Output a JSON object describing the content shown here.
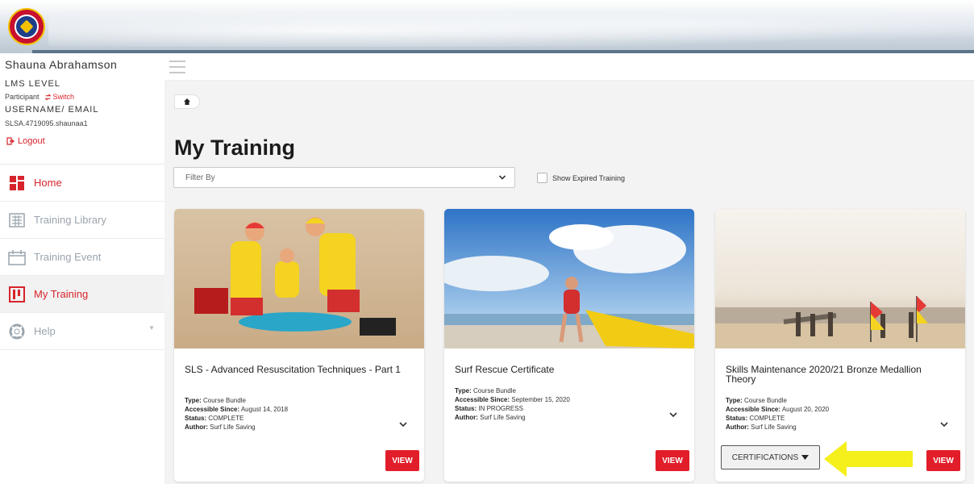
{
  "colors": {
    "brand_red": "#e21d2a",
    "sidebar_red": "#d6242a",
    "title_dark": "#1b1b1b",
    "highlight_yellow": "#f5ef1c"
  },
  "user": {
    "name": "Shauna Abrahamson",
    "lms_level_label": "LMS LEVEL",
    "role": "Participant",
    "switch_label": "Switch",
    "username_label": "USERNAME/ EMAIL",
    "username_value": "SLSA.4719095.shaunaa1",
    "logout_label": "Logout"
  },
  "nav": {
    "items": [
      {
        "label": "Home",
        "icon": "home-grid-icon"
      },
      {
        "label": "Training Library",
        "icon": "library-icon"
      },
      {
        "label": "Training Event",
        "icon": "calendar-icon"
      },
      {
        "label": "My Training",
        "icon": "my-training-icon"
      },
      {
        "label": "Help",
        "icon": "lifebuoy-icon"
      }
    ]
  },
  "main": {
    "title": "My Training",
    "filter_placeholder": "Filter By",
    "show_expired_label": "Show Expired Training"
  },
  "cards": [
    {
      "title": "SLS - Advanced Resuscitation Techniques - Part 1",
      "type_label": "Type:",
      "type": "Course Bundle",
      "accessible_label": "Accessible Since:",
      "accessible": "August 14, 2018",
      "status_label": "Status:",
      "status": "COMPLETE",
      "author_label": "Author:",
      "author": "Surf Life Saving",
      "view_label": "VIEW"
    },
    {
      "title": "Surf Rescue Certificate",
      "type_label": "Type:",
      "type": "Course Bundle",
      "accessible_label": "Accessible Since:",
      "accessible": "September 15, 2020",
      "status_label": "Status:",
      "status": "IN PROGRESS",
      "author_label": "Author:",
      "author": "Surf Life Saving",
      "view_label": "VIEW"
    },
    {
      "title": "Skills Maintenance 2020/21 Bronze Medallion Theory",
      "type_label": "Type:",
      "type": "Course Bundle",
      "accessible_label": "Accessible Since:",
      "accessible": "August 20, 2020",
      "status_label": "Status:",
      "status": "COMPLETE",
      "author_label": "Author:",
      "author": "Surf Life Saving",
      "view_label": "VIEW",
      "certifications_label": "CERTIFICATIONS"
    }
  ]
}
